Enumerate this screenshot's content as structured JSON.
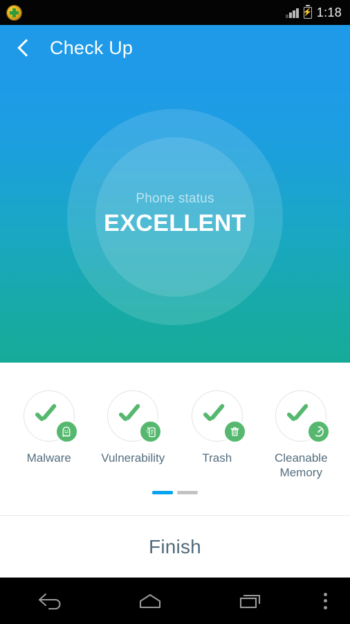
{
  "statusbar": {
    "app_icon": "shield-plus-icon",
    "signal_icon": "signal-bars-icon",
    "battery_icon": "battery-charging-icon",
    "time": "1:18"
  },
  "appbar": {
    "back_icon": "back-chevron-icon",
    "title": "Check Up"
  },
  "hero": {
    "subtitle": "Phone status",
    "status": "EXCELLENT",
    "gradient_top": "#1e9ae8",
    "gradient_bottom": "#16ab98"
  },
  "results": {
    "accent_color": "#56b86f",
    "items": [
      {
        "label": "Malware",
        "badge_icon": "ghost-icon",
        "check_icon": "check-icon"
      },
      {
        "label": "Vulnerability",
        "badge_icon": "phone-scan-icon",
        "check_icon": "check-icon"
      },
      {
        "label": "Trash",
        "badge_icon": "trash-icon",
        "check_icon": "check-icon"
      },
      {
        "label": "Cleanable Memory",
        "badge_icon": "speedometer-icon",
        "check_icon": "check-icon"
      }
    ]
  },
  "pager": {
    "active_index": 0,
    "count": 2,
    "active_color": "#06a3f0",
    "inactive_color": "#c3c3c3"
  },
  "footer": {
    "finish_label": "Finish"
  },
  "navbar": {
    "back_icon": "nav-back-icon",
    "home_icon": "nav-home-icon",
    "recents_icon": "nav-recents-icon",
    "overflow_icon": "nav-overflow-icon"
  }
}
